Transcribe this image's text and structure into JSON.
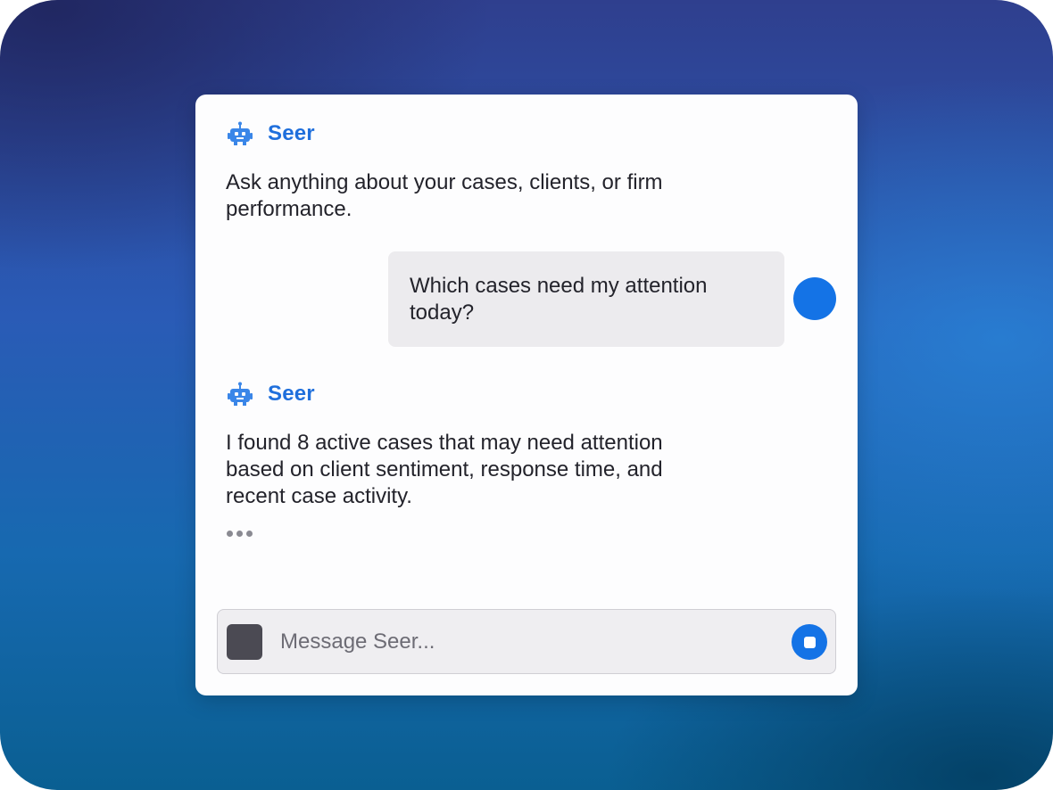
{
  "assistant": {
    "name": "Seer",
    "icon": "robot-icon",
    "accent_color": "#1f6fdc"
  },
  "messages": [
    {
      "role": "assistant",
      "text": "Ask anything about your cases, clients, or firm performance."
    },
    {
      "role": "user",
      "text": "Which cases need my attention today?"
    },
    {
      "role": "assistant",
      "text": "I found 8 active cases that may need attention based on client sentiment, response time, and recent case activity."
    }
  ],
  "typing_indicator": "•••",
  "composer": {
    "placeholder": "Message Seer...",
    "value": "",
    "send_icon": "stop-icon",
    "attach_icon": "attachment-icon"
  },
  "colors": {
    "user_avatar": "#1473e6",
    "send_button": "#1473e6"
  }
}
